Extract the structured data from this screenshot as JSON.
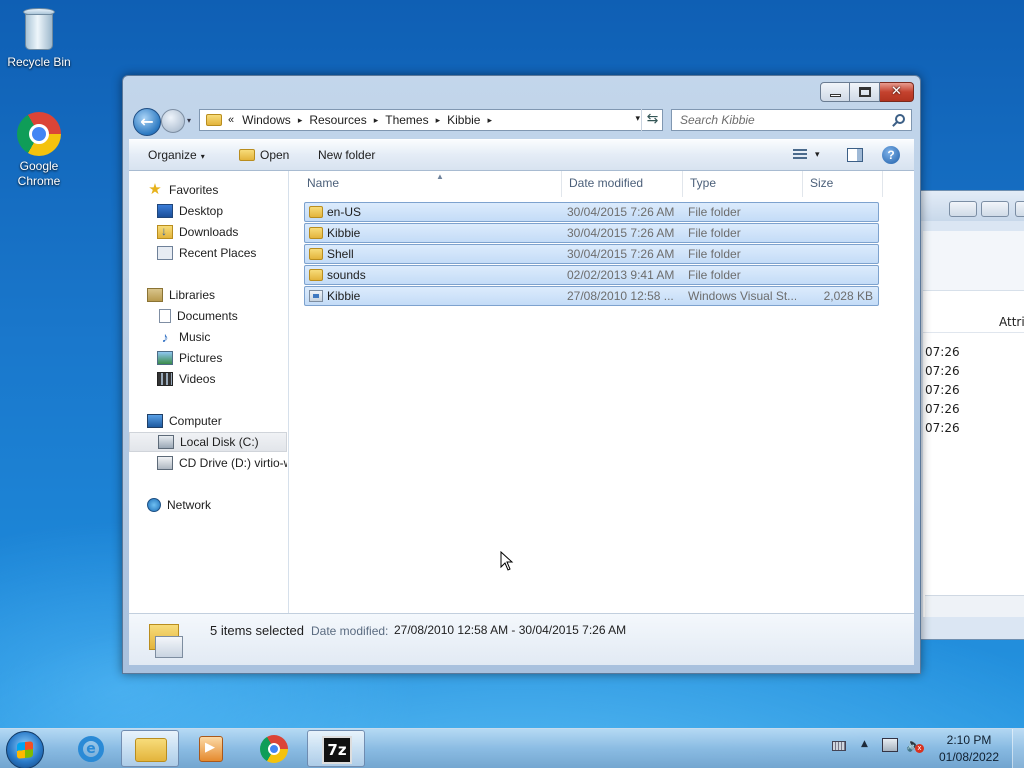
{
  "desktop": {
    "icons": [
      {
        "label": "Recycle Bin",
        "icon": "recycle-bin-icon"
      },
      {
        "label": "Google Chrome",
        "icon": "chrome-icon"
      }
    ]
  },
  "background_window": {
    "column_header": "Attril",
    "times": [
      "07:26",
      "07:26",
      "07:26",
      "07:26",
      "07:26"
    ]
  },
  "explorer": {
    "caption_buttons": {
      "minimize": "minimize",
      "maximize": "maximize",
      "close": "✕"
    },
    "nav": {
      "back_glyph": "←",
      "chevron": "«"
    },
    "address": {
      "segments": [
        "Windows",
        "Resources",
        "Themes",
        "Kibbie"
      ],
      "separator": "▸"
    },
    "search": {
      "placeholder": "Search Kibbie"
    },
    "commands": {
      "organize": "Organize",
      "organize_caret": "▾",
      "open": "Open",
      "new_folder": "New folder",
      "view_caret": "▾",
      "help": "?"
    },
    "nav_pane": {
      "favorites": {
        "label": "Favorites",
        "items": [
          "Desktop",
          "Downloads",
          "Recent Places"
        ]
      },
      "libraries": {
        "label": "Libraries",
        "items": [
          "Documents",
          "Music",
          "Pictures",
          "Videos"
        ]
      },
      "computer": {
        "label": "Computer",
        "items": [
          "Local Disk (C:)",
          "CD Drive (D:) virtio-w"
        ]
      },
      "network": {
        "label": "Network"
      }
    },
    "columns": {
      "name": "Name",
      "date_modified": "Date modified",
      "type": "Type",
      "size": "Size"
    },
    "files": [
      {
        "name": "en-US",
        "date": "30/04/2015 7:26 AM",
        "type": "File folder",
        "size": "",
        "icon": "folder-icon"
      },
      {
        "name": "Kibbie",
        "date": "30/04/2015 7:26 AM",
        "type": "File folder",
        "size": "",
        "icon": "folder-icon"
      },
      {
        "name": "Shell",
        "date": "30/04/2015 7:26 AM",
        "type": "File folder",
        "size": "",
        "icon": "folder-icon"
      },
      {
        "name": "sounds",
        "date": "02/02/2013 9:41 AM",
        "type": "File folder",
        "size": "",
        "icon": "folder-icon"
      },
      {
        "name": "Kibbie",
        "date": "27/08/2010 12:58 ...",
        "type": "Windows Visual St...",
        "size": "2,028 KB",
        "icon": "theme-file-icon"
      }
    ],
    "details": {
      "count": "5 items selected",
      "date_label": "Date modified:",
      "date_value": "27/08/2010 12:58 AM - 30/04/2015 7:26 AM"
    }
  },
  "taskbar": {
    "buttons": [
      "start",
      "internet-explorer",
      "windows-explorer",
      "media-player",
      "chrome",
      "7-zip"
    ],
    "seven_zip_label": "7z",
    "ie_label": "e",
    "tray_up": "▲",
    "volume_glyph": "🔈",
    "volume_mute": "x",
    "clock": {
      "time": "2:10 PM",
      "date": "01/08/2022"
    }
  }
}
